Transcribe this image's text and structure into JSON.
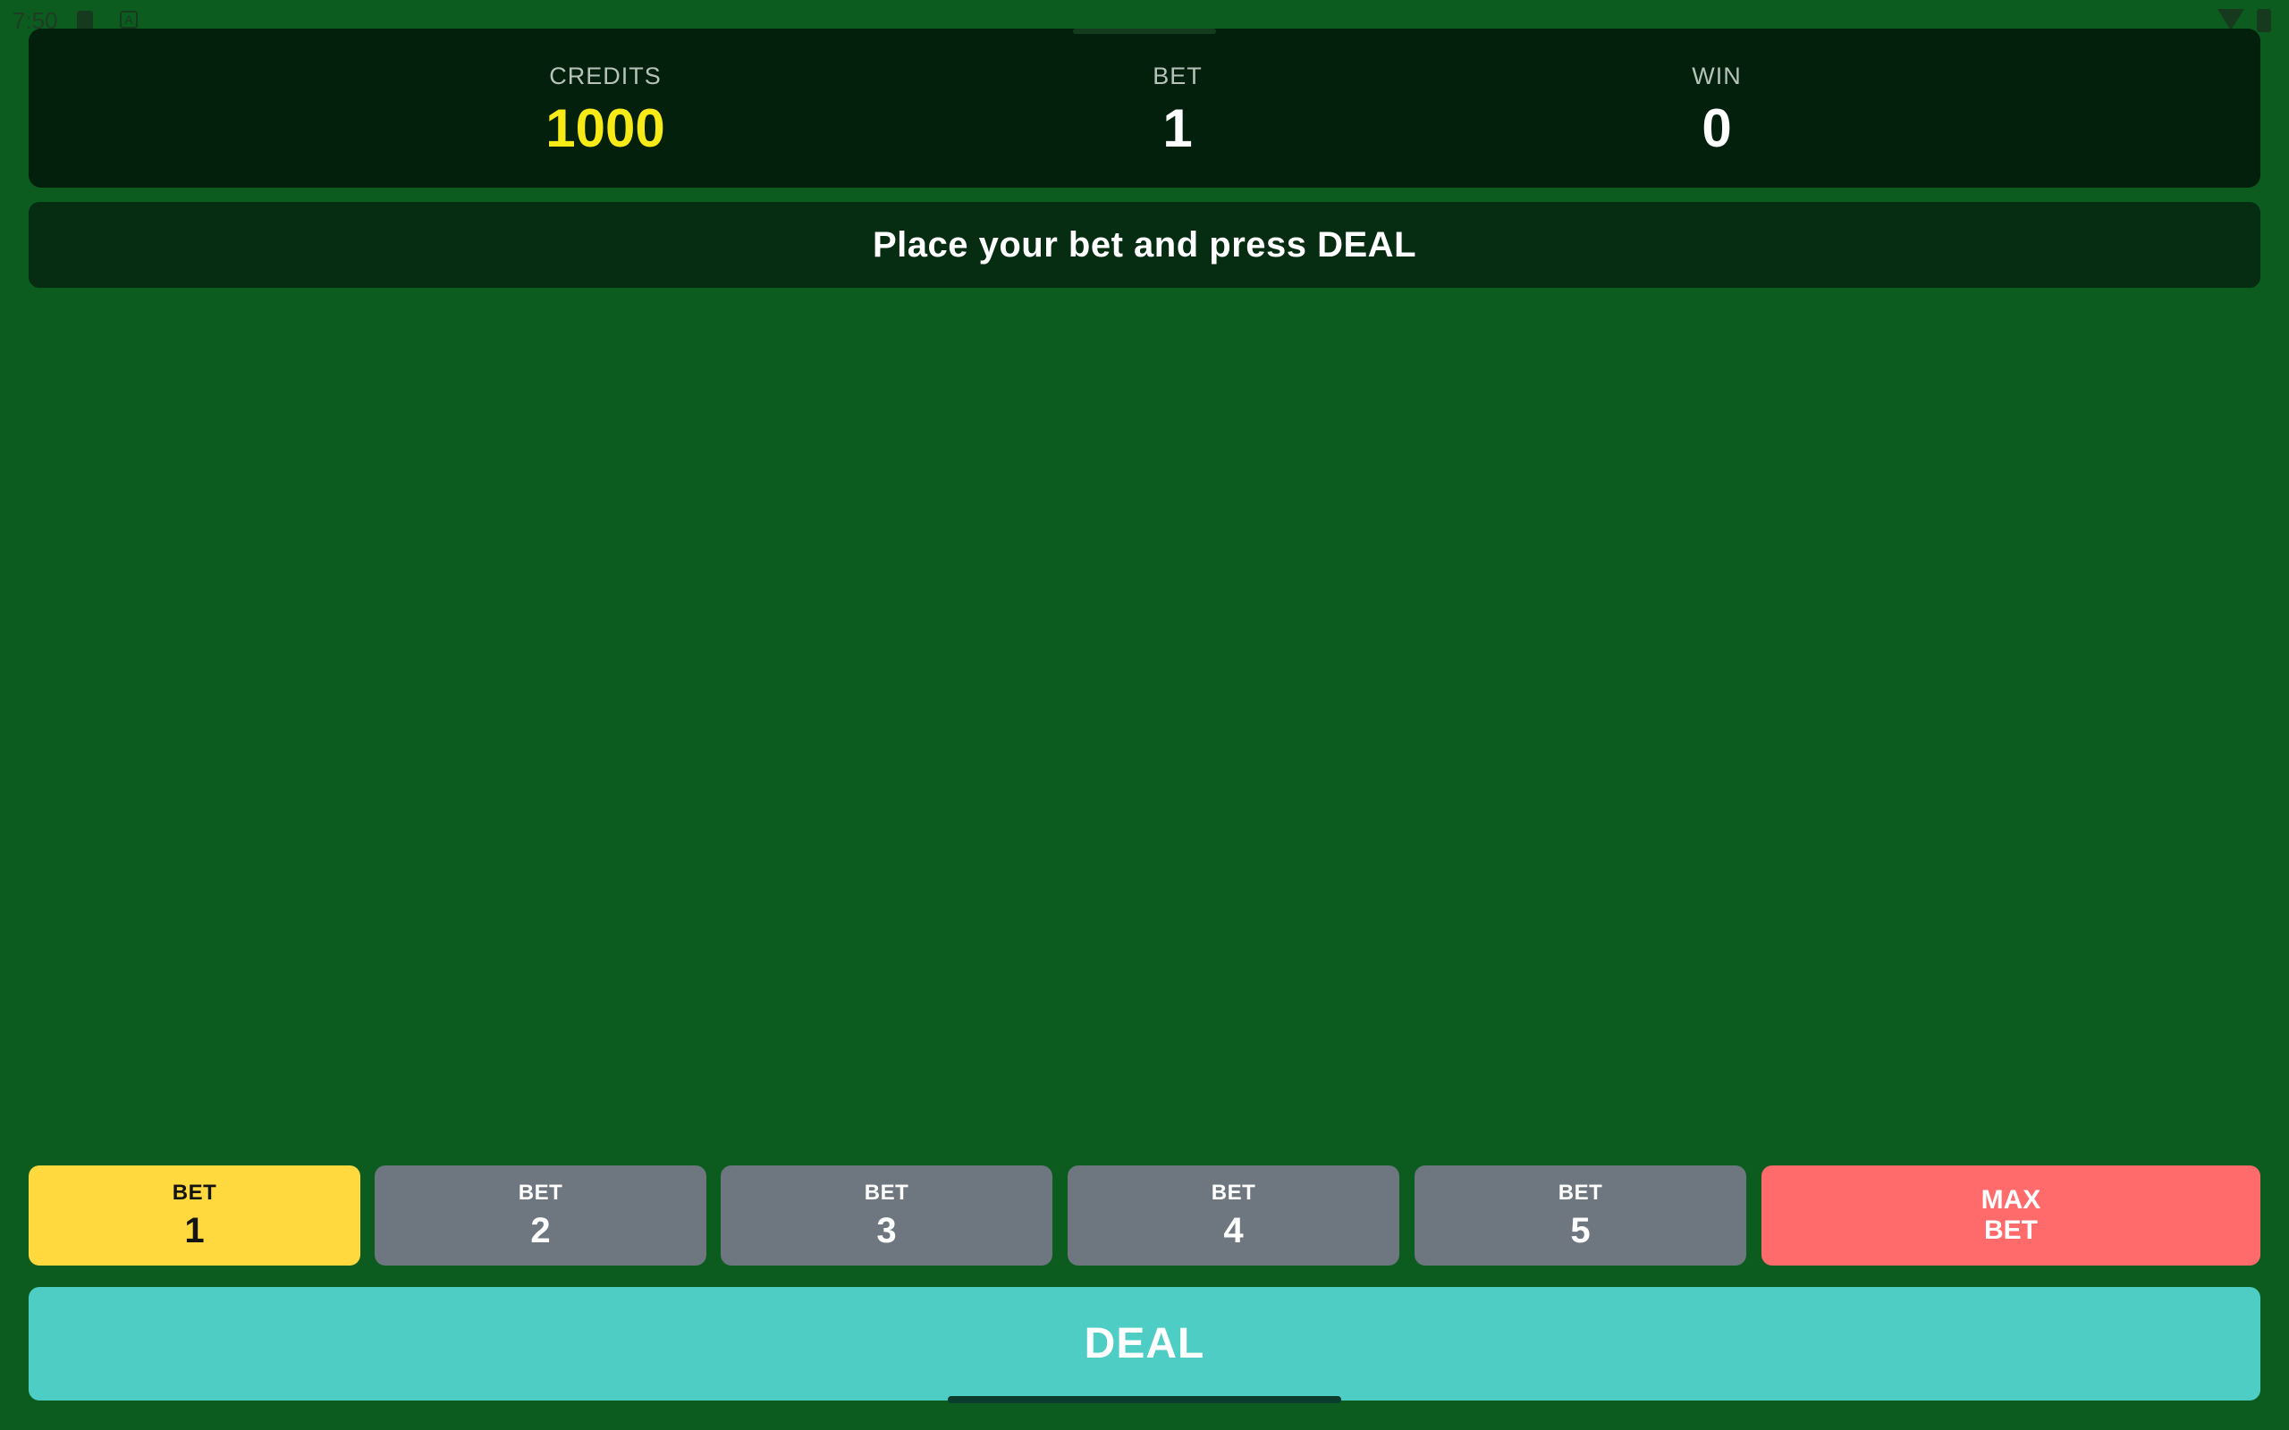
{
  "status_bar": {
    "time": "7:50"
  },
  "stats": {
    "credits_label": "CREDITS",
    "credits_value": "1000",
    "bet_label": "BET",
    "bet_value": "1",
    "win_label": "WIN",
    "win_value": "0"
  },
  "message": "Place your bet and press DEAL",
  "bet_buttons": [
    {
      "label": "BET",
      "value": "1",
      "selected": true
    },
    {
      "label": "BET",
      "value": "2",
      "selected": false
    },
    {
      "label": "BET",
      "value": "3",
      "selected": false
    },
    {
      "label": "BET",
      "value": "4",
      "selected": false
    },
    {
      "label": "BET",
      "value": "5",
      "selected": false
    }
  ],
  "max_bet": {
    "line1": "MAX",
    "line2": "BET"
  },
  "deal_label": "DEAL",
  "colors": {
    "table_green": "#0c5c1f",
    "credits_yellow": "#f7ea17",
    "selected_bet": "#ffd93e",
    "bet_gray": "#6e7680",
    "max_bet_red": "#ff6b6b",
    "deal_teal": "#4ecdc4"
  }
}
